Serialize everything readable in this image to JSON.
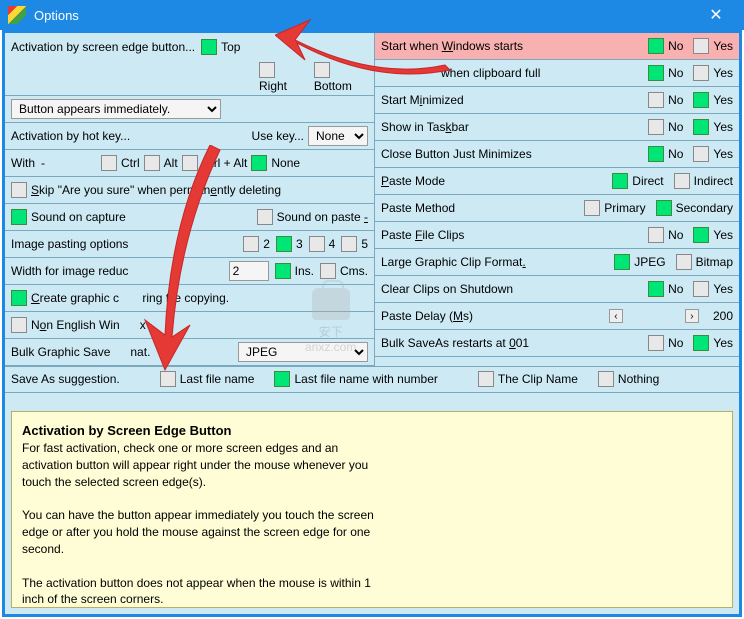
{
  "title": "Options",
  "left": {
    "activation_label": "Activation by screen edge button...",
    "top": "Top",
    "right": "Right",
    "bottom": "Bottom",
    "button_appears_select": "Button appears immediately.",
    "hotkey_label": "Activation by hot key...",
    "use_key": "Use key...",
    "use_key_val": "None",
    "with": "With",
    "dash": "-",
    "ctrl": "Ctrl",
    "alt": "Alt",
    "ctrlalt": "Ctrl + Alt",
    "none": "None",
    "skip": "Skip \"Are you sure\" when permanently deleting",
    "sound_capture": "Sound on capture",
    "sound_paste": "Sound on paste -",
    "image_pasting": "Image pasting options",
    "n2": "2",
    "n3": "3",
    "n4": "4",
    "n5": "5",
    "width_reduce": "Width for image reduc",
    "width_val": "2",
    "ins": "Ins.",
    "cms": "Cms.",
    "create_graphic": "Create graphic c",
    "create_graphic2": "ring file copying.",
    "non_english": "Non English Win",
    "non_english2": "x",
    "bulk_save": "Bulk Graphic Save",
    "bulk_save2": "nat.",
    "bulk_select": "JPEG",
    "saveas": "Save As suggestion.",
    "last_fn": "Last file name",
    "last_fn_num": "Last file name with number",
    "clip_name": "The Clip Name",
    "nothing": "Nothing"
  },
  "right": {
    "start_windows": "Start when Windows starts",
    "clipboard_full": "when clipboard full",
    "start_min": "Start Minimized",
    "show_taskbar": "Show in Taskbar",
    "close_min": "Close Button Just Minimizes",
    "paste_mode": "Paste Mode",
    "direct": "Direct",
    "indirect": "Indirect",
    "paste_method": "Paste Method",
    "primary": "Primary",
    "secondary": "Secondary",
    "paste_file": "Paste File Clips",
    "large_graphic": "Large Graphic Clip Format.",
    "jpeg": "JPEG",
    "bitmap": "Bitmap",
    "clear_shutdown": "Clear Clips on Shutdown",
    "paste_delay": "Paste Delay (Ms)",
    "delay_val": "200",
    "bulk_restart": "Bulk SaveAs restarts at 001",
    "no": "No",
    "yes": "Yes"
  },
  "desc": {
    "title": "Activation by Screen Edge Button",
    "p1": "For fast activation, check one or more screen edges and an activation button will appear right under the mouse whenever you touch the selected screen edge(s).",
    "p2": "You can have the button appear immediately you touch the screen edge or after you hold the mouse against the screen edge for one second.",
    "p3": "The activation button does not appear when the mouse is within 1 inch of the screen corners."
  },
  "watermark": "anxz.com"
}
